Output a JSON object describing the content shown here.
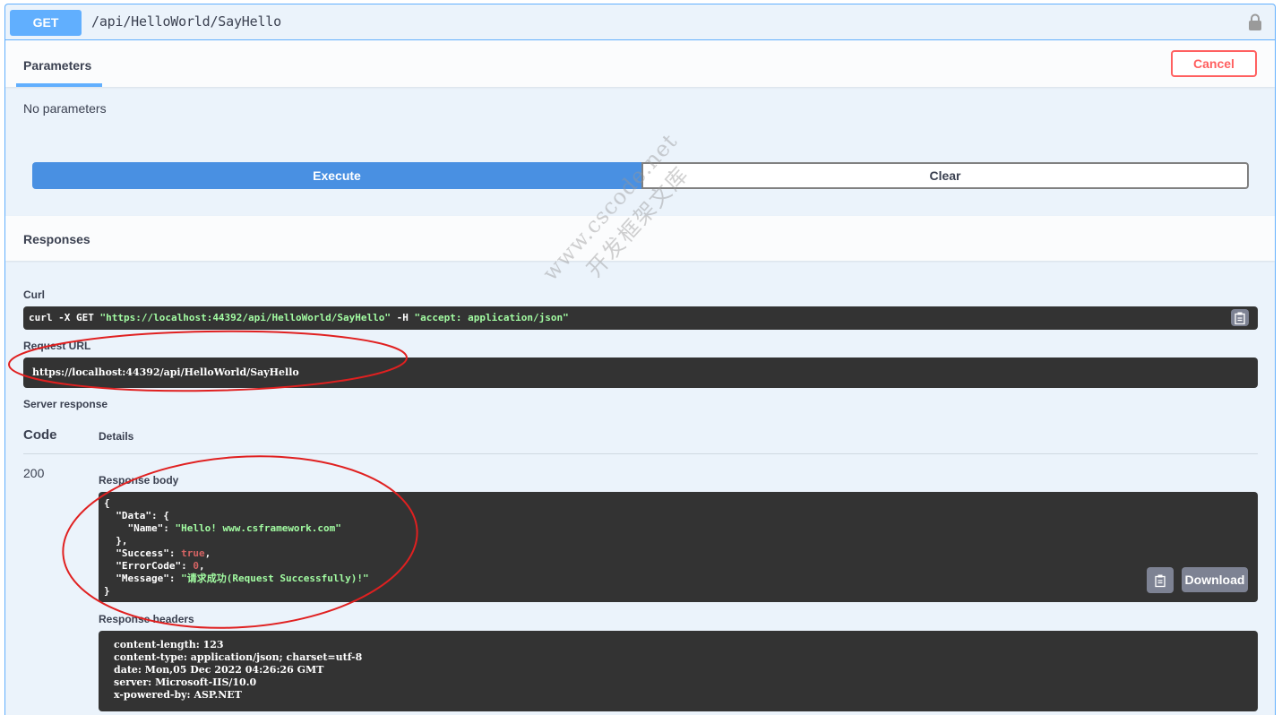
{
  "endpoint": {
    "method": "GET",
    "path": "/api/HelloWorld/SayHello"
  },
  "parameters": {
    "tab_label": "Parameters",
    "cancel_label": "Cancel",
    "empty_text": "No parameters",
    "execute_label": "Execute",
    "clear_label": "Clear"
  },
  "responses": {
    "title": "Responses",
    "curl_label": "Curl",
    "curl": {
      "prefix": "curl -X GET ",
      "url": "\"https://localhost:44392/api/HelloWorld/SayHello\"",
      "flag": " -H  ",
      "header": "\"accept: application/json\""
    },
    "request_url_label": "Request URL",
    "request_url": "https://localhost:44392/api/HelloWorld/SayHello",
    "server_response_label": "Server response",
    "code_header": "Code",
    "details_header": "Details",
    "status_code": "200",
    "response_body_label": "Response body",
    "body": {
      "l1": "{",
      "l2_key": "  \"Data\": {",
      "l3_key": "    \"Name\": ",
      "l3_val": "\"Hello! www.csframework.com\"",
      "l4": "  },",
      "l5_key": "  \"Success\": ",
      "l5_val": "true",
      "l6_key": "  \"ErrorCode\": ",
      "l6_val": "0",
      "l7_key": "  \"Message\": ",
      "l7_val": "\"请求成功(Request Successfully)!\"",
      "l8": "}",
      "comma": ","
    },
    "download_label": "Download",
    "response_headers_label": "Response headers",
    "headers": [
      "content-length: 123",
      "content-type: application/json; charset=utf-8",
      "date: Mon,05 Dec 2022 04:26:26 GMT",
      "server: Microsoft-IIS/10.0",
      "x-powered-by: ASP.NET"
    ]
  },
  "watermark": {
    "line1": "www.cscode.net",
    "line2": "开发框架文库"
  },
  "colors": {
    "get_accent": "#61affe",
    "execute": "#4990e2",
    "cancel": "#ff6060",
    "code_bg": "#333333",
    "string": "#a2fca2",
    "number": "#d36363",
    "annotation": "#e02020"
  },
  "icons": {
    "lock": "lock-icon",
    "copy": "clipboard-copy-icon"
  }
}
